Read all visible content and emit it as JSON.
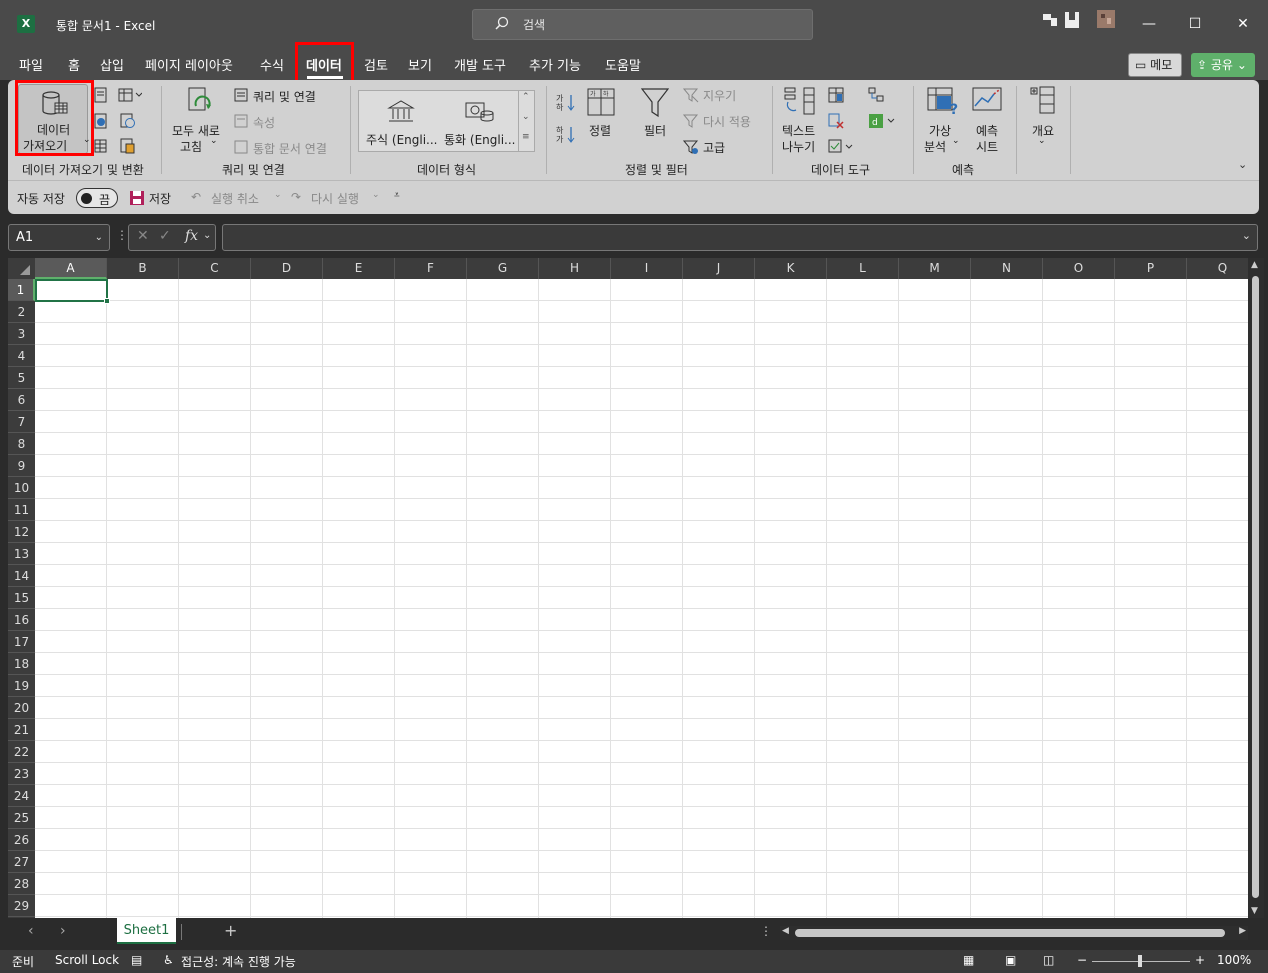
{
  "titlebar": {
    "doc_title": "통합 문서1  -  Excel",
    "search_placeholder": "검색",
    "minimize": "—",
    "maximize": "☐",
    "close": "✕"
  },
  "tabs": [
    "파일",
    "홈",
    "삽입",
    "페이지 레이아웃",
    "수식",
    "데이터",
    "검토",
    "보기",
    "개발 도구",
    "추가 기능",
    "도움말"
  ],
  "active_tab": "데이터",
  "header_buttons": {
    "memo": "메모",
    "share": "공유"
  },
  "ribbon": {
    "get_data": {
      "line1": "데이터",
      "line2": "가져오기"
    },
    "group_get_transform": "데이터 가져오기 및 변환",
    "refresh_all": {
      "line1": "모두 새로",
      "line2": "고침"
    },
    "queries_connections": "쿼리 및 연결",
    "properties": "속성",
    "edit_links": "통합 문서 연결",
    "group_queries": "쿼리 및 연결",
    "stocks": "주식 (Engli...",
    "currencies": "통화 (Engli...",
    "group_data_types": "데이터 형식",
    "sort": "정렬",
    "filter": "필터",
    "clear": "지우기",
    "reapply": "다시 적용",
    "advanced": "고급",
    "group_sort_filter": "정렬 및 필터",
    "text_to_columns": {
      "line1": "텍스트",
      "line2": "나누기"
    },
    "group_data_tools": "데이터 도구",
    "what_if": {
      "line1": "가상",
      "line2": "분석"
    },
    "forecast_sheet": {
      "line1": "예측",
      "line2": "시트"
    },
    "group_forecast": "예측",
    "outline": "개요"
  },
  "qat": {
    "autosave": "자동 저장",
    "autosave_state": "끔",
    "save": "저장",
    "undo": "실행 취소",
    "redo": "다시 실행"
  },
  "formula_bar": {
    "name_box": "A1",
    "fx": "fx",
    "formula": ""
  },
  "grid": {
    "columns": [
      "A",
      "B",
      "C",
      "D",
      "E",
      "F",
      "G",
      "H",
      "I",
      "J",
      "K",
      "L",
      "M",
      "N",
      "O",
      "P",
      "Q"
    ],
    "rows": [
      "1",
      "2",
      "3",
      "4",
      "5",
      "6",
      "7",
      "8",
      "9",
      "10",
      "11",
      "12",
      "13",
      "14",
      "15",
      "16",
      "17",
      "18",
      "19",
      "20",
      "21",
      "22",
      "23",
      "24",
      "25",
      "26",
      "27",
      "28",
      "29"
    ],
    "active_cell": "A1"
  },
  "sheets": [
    "Sheet1"
  ],
  "statusbar": {
    "ready": "준비",
    "scroll_lock": "Scroll Lock",
    "accessibility": "접근성: 계속 진행 가능",
    "zoom": "100%"
  },
  "colors": {
    "excel_green": "#217346",
    "highlight_red": "#ff0000",
    "share_green": "#5fb06b"
  }
}
